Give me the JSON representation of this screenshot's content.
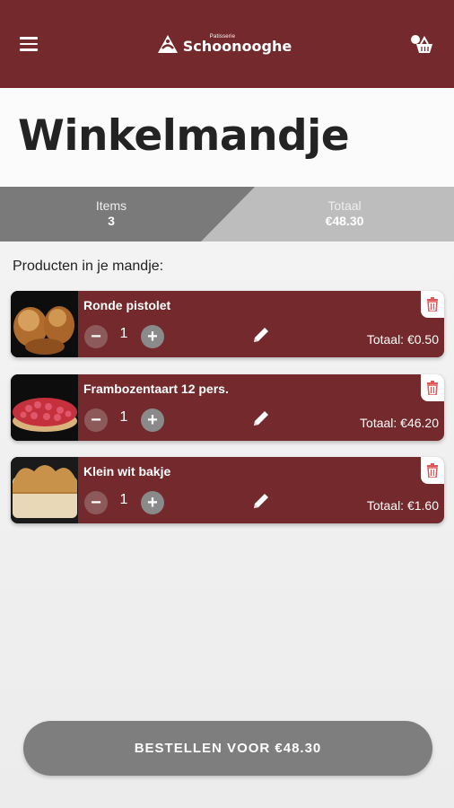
{
  "header": {
    "logo_small": "Patisserie",
    "logo_big": "Schoonooghe"
  },
  "page_title": "Winkelmandje",
  "summary": {
    "items_label": "Items",
    "items_value": "3",
    "total_label": "Totaal",
    "total_value": "€48.30"
  },
  "section_label": "Producten in je mandje:",
  "products": [
    {
      "name": "Ronde pistolet",
      "quantity": "1",
      "total": "Totaal: €0.50",
      "image": "bread-rolls"
    },
    {
      "name": "Frambozentaart 12 pers.",
      "quantity": "1",
      "total": "Totaal: €46.20",
      "image": "raspberry-tart"
    },
    {
      "name": "Klein wit bakje",
      "quantity": "1",
      "total": "Totaal: €1.60",
      "image": "white-bread"
    }
  ],
  "controls": {
    "minus": "−",
    "plus": "+"
  },
  "order_button": "BESTELLEN VOOR €48.30",
  "colors": {
    "brand": "#742a2c",
    "summary_dark": "#7a7a7a",
    "summary_light": "#bdbdbd",
    "button": "#7e7e7e",
    "trash": "#e05555"
  }
}
